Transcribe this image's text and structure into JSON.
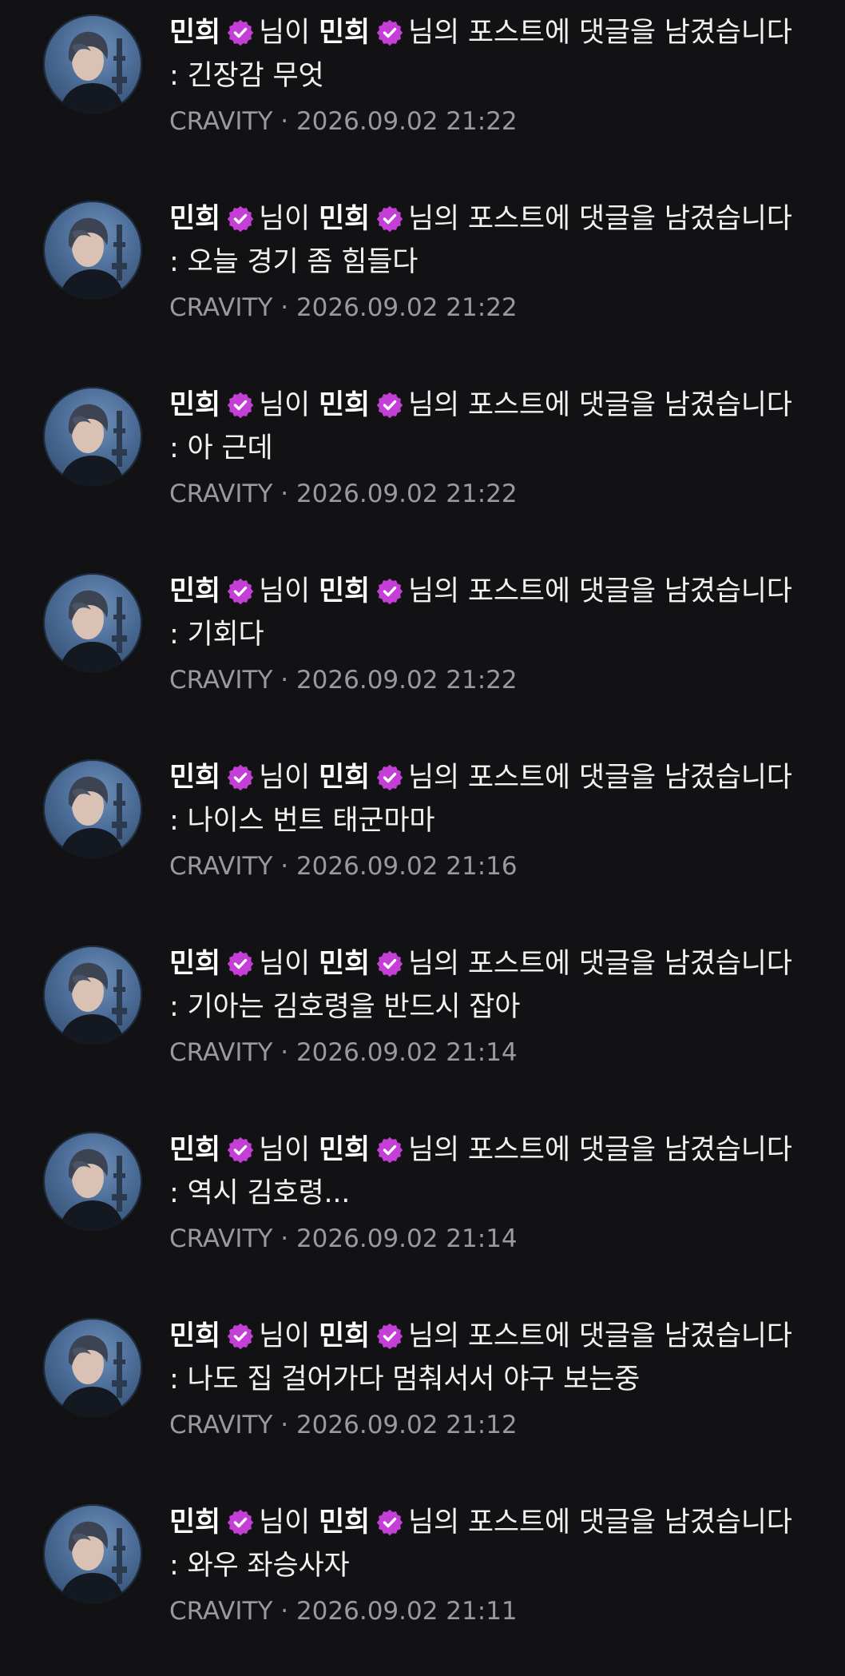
{
  "colors": {
    "background": "#121214",
    "text": "#f2f2f2",
    "meta": "#9a9a9e",
    "badge": "#c43fd6"
  },
  "badge_icon": "verified-badge-icon",
  "notifications": [
    {
      "actor": "민희",
      "mid": "님이",
      "target": "민희",
      "action": "님의 포스트에 댓글을 남겼습니다 : 긴장감 무엇",
      "group": "CRAVITY",
      "sep": "·",
      "time": "2026.09.02 21:22"
    },
    {
      "actor": "민희",
      "mid": "님이",
      "target": "민희",
      "action": "님의 포스트에 댓글을 남겼습니다 : 오늘 경기 좀 힘들다",
      "group": "CRAVITY",
      "sep": "·",
      "time": "2026.09.02 21:22"
    },
    {
      "actor": "민희",
      "mid": "님이",
      "target": "민희",
      "action": "님의 포스트에 댓글을 남겼습니다 : 아 근데",
      "group": "CRAVITY",
      "sep": "·",
      "time": "2026.09.02 21:22"
    },
    {
      "actor": "민희",
      "mid": "님이",
      "target": "민희",
      "action": "님의 포스트에 댓글을 남겼습니다 : 기회다",
      "group": "CRAVITY",
      "sep": "·",
      "time": "2026.09.02 21:22"
    },
    {
      "actor": "민희",
      "mid": "님이",
      "target": "민희",
      "action": "님의 포스트에 댓글을 남겼습니다 : 나이스 번트 태군마마",
      "group": "CRAVITY",
      "sep": "·",
      "time": "2026.09.02 21:16"
    },
    {
      "actor": "민희",
      "mid": "님이",
      "target": "민희",
      "action": "님의 포스트에 댓글을 남겼습니다 : 기아는 김호령을 반드시 잡아",
      "group": "CRAVITY",
      "sep": "·",
      "time": "2026.09.02 21:14"
    },
    {
      "actor": "민희",
      "mid": "님이",
      "target": "민희",
      "action": "님의 포스트에 댓글을 남겼습니다 : 역시 김호령...",
      "group": "CRAVITY",
      "sep": "·",
      "time": "2026.09.02 21:14"
    },
    {
      "actor": "민희",
      "mid": "님이",
      "target": "민희",
      "action": "님의 포스트에 댓글을 남겼습니다 : 나도 집 걸어가다 멈춰서서 야구 보는중",
      "group": "CRAVITY",
      "sep": "·",
      "time": "2026.09.02 21:12"
    },
    {
      "actor": "민희",
      "mid": "님이",
      "target": "민희",
      "action": "님의 포스트에 댓글을 남겼습니다 : 와우 좌승사자",
      "group": "CRAVITY",
      "sep": "·",
      "time": "2026.09.02 21:11"
    }
  ]
}
